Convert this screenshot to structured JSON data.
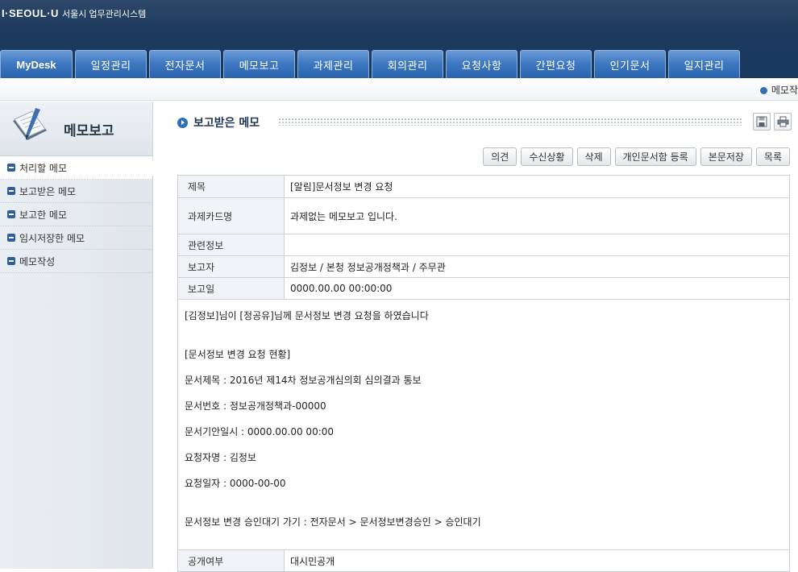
{
  "header": {
    "logo": "I·SEOUL·U",
    "system_name": "서울시 업무관리시스템",
    "tabs": [
      "MyDesk",
      "일정관리",
      "전자문서",
      "메모보고",
      "과제관리",
      "회의관리",
      "요청사항",
      "간편요청",
      "인기문서",
      "일지관리"
    ],
    "subbar_link": "메모작"
  },
  "sidebar": {
    "title": "메모보고",
    "items": [
      {
        "label": "처리할 메모",
        "active": true
      },
      {
        "label": "보고받은 메모"
      },
      {
        "label": "보고한 메모"
      },
      {
        "label": "임시저장한 메모"
      },
      {
        "label": "메모작성"
      }
    ]
  },
  "main": {
    "page_title": "보고받은 메모",
    "buttons": [
      "의견",
      "수신상황",
      "삭제",
      "개인문서함 등록",
      "본문저장",
      "목록"
    ],
    "fields": [
      {
        "label": "제목",
        "value": "[알림]문서정보 변경 요청"
      },
      {
        "label": "과제카드명",
        "value": "과제없는 메모보고 입니다."
      },
      {
        "label": "관련정보",
        "value": ""
      },
      {
        "label": "보고자",
        "value": "김정보 / 본청 정보공개정책과 / 주무관"
      },
      {
        "label": "보고일",
        "value": "0000.00.00 00:00:00"
      }
    ],
    "body": [
      "[김정보]님이 [정공유]님께 문서정보 변경 요청을 하였습니다",
      "",
      "[문서정보 변경 요청 현황]",
      "문서제목 : 2016년 제14차 정보공개심의회 심의결과 통보",
      "문서번호 : 정보공개정책과-00000",
      "문서기안일시 : 0000.00.00 00:00",
      "요청자명 : 김정보",
      "요청일자 : 0000-00-00",
      "",
      "문서정보 변경 승인대기 가기 : 전자문서 > 문서정보변경승인 > 승인대기"
    ],
    "footer_field": {
      "label": "공개여부",
      "value": "대시민공개"
    }
  }
}
